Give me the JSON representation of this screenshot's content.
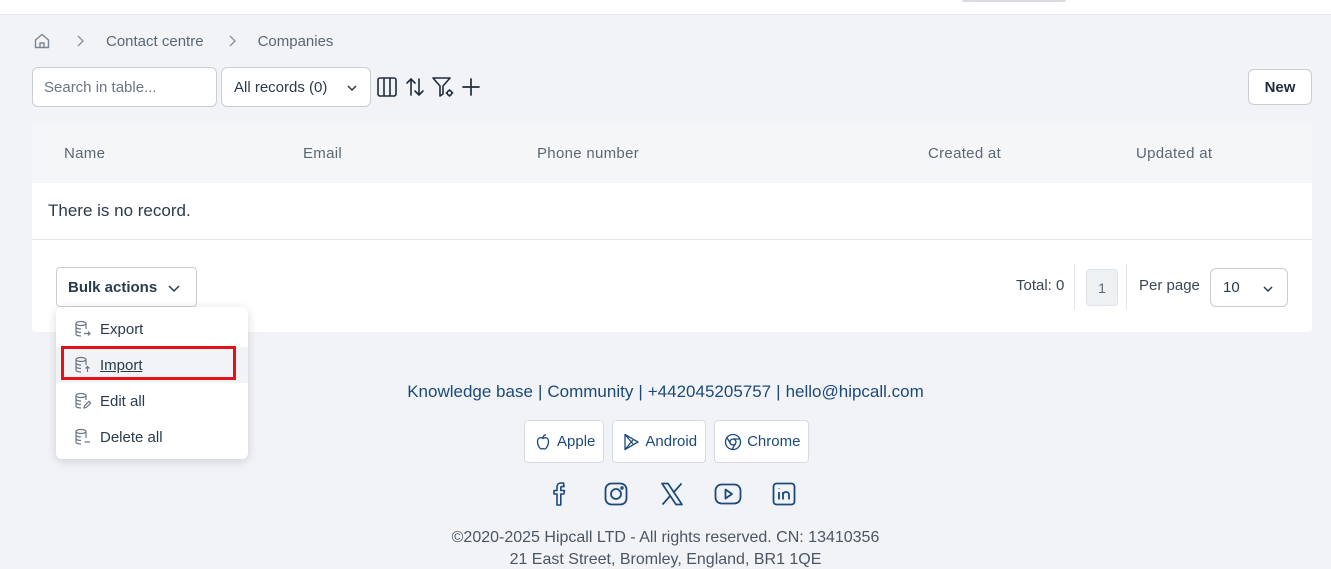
{
  "breadcrumb": {
    "items": [
      "Contact centre",
      "Companies"
    ]
  },
  "toolbar": {
    "search_placeholder": "Search in table...",
    "records_filter": "All records (0)",
    "new_label": "New"
  },
  "table": {
    "columns": [
      "Name",
      "Email",
      "Phone number",
      "Created at",
      "Updated at"
    ],
    "empty_text": "There is no record."
  },
  "footer_bar": {
    "bulk_label": "Bulk actions",
    "total_label": "Total: 0",
    "current_page": "1",
    "per_page_label": "Per page",
    "per_page_value": "10"
  },
  "bulk_menu": {
    "items": [
      {
        "label": "Export",
        "icon": "database-export-icon"
      },
      {
        "label": "Import",
        "icon": "database-import-icon"
      },
      {
        "label": "Edit all",
        "icon": "database-edit-icon"
      },
      {
        "label": "Delete all",
        "icon": "database-delete-icon"
      }
    ],
    "highlighted": "Import"
  },
  "footer": {
    "links": [
      "Knowledge base",
      "Community",
      "+442045205757",
      "hello@hipcall.com"
    ],
    "apps": [
      "Apple",
      "Android",
      "Chrome"
    ],
    "socials": [
      "facebook-icon",
      "instagram-icon",
      "x-icon",
      "youtube-icon",
      "linkedin-icon"
    ],
    "copyright": "©2020-2025 Hipcall LTD - All rights reserved. CN: 13410356",
    "address": "21 East Street, Bromley, England, BR1 1QE"
  },
  "colors": {
    "background": "#f1f3f6",
    "link": "#1c4a7a",
    "highlight": "#e4101a"
  }
}
